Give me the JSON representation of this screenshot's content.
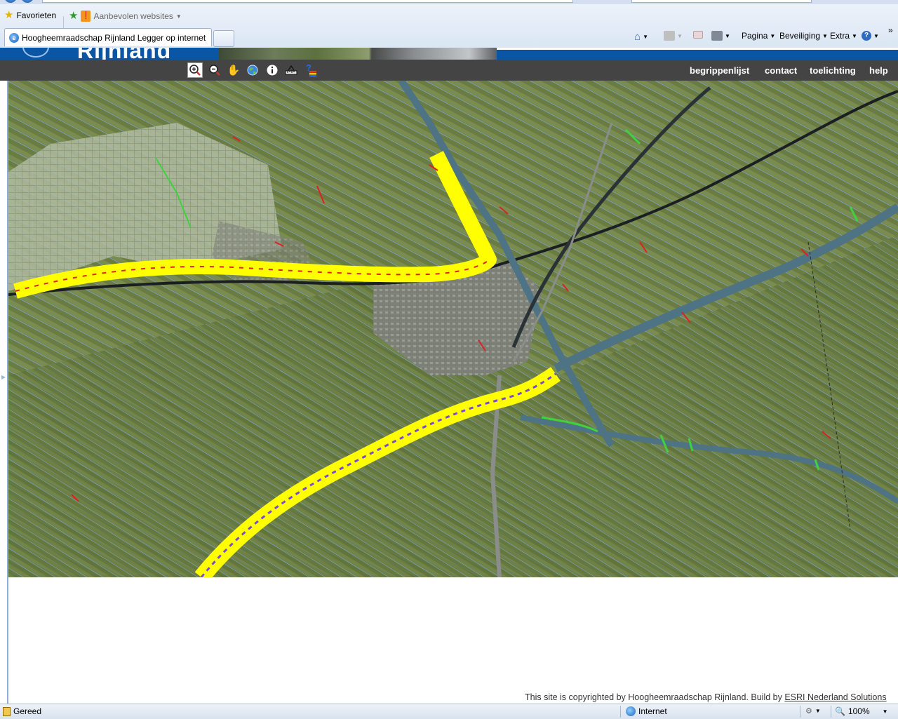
{
  "browser": {
    "favorites_label": "Favorieten",
    "suggested_sites_label": "Aanbevolen websites",
    "tab_title": "Hoogheemraadschap Rijnland Legger op internet",
    "commands": {
      "page": "Pagina",
      "security": "Beveiliging",
      "extra": "Extra"
    },
    "more_chevron": "»"
  },
  "site": {
    "logo_text": "Rijnland",
    "nav": {
      "glossary": "begrippenlijst",
      "contact": "contact",
      "explanation": "toelichting",
      "help": "help"
    },
    "tools": [
      "zoom-in-icon",
      "zoom-out-icon",
      "pan-hand-icon",
      "full-extent-globe-icon",
      "info-icon",
      "measure-icon",
      "legend-layers-icon"
    ],
    "active_tool": "zoom-in-icon",
    "footer": {
      "copyright_prefix": "This site is copyrighted by Hoogheemraadschap Rijnland. Build by ",
      "copyright_link": "ESRI Nederland Solutions"
    }
  },
  "status": {
    "text": "Gereed",
    "zone": "Internet",
    "zoom": "100%"
  },
  "colors": {
    "toolbar_bg": "#444444",
    "brand_blue": "#0a55a4",
    "legger_highlight": "#ffff00",
    "watercourse": "#5a86a6",
    "structure_red": "#e02020",
    "structure_green": "#3fd13f"
  }
}
